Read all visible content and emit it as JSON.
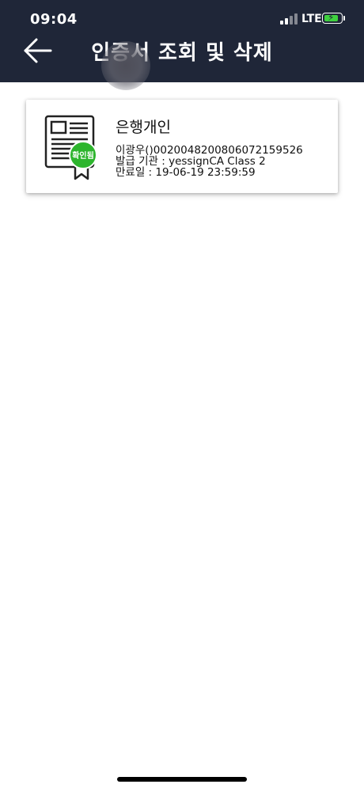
{
  "status_bar": {
    "time": "09:04",
    "network": "LTE",
    "battery_level": 0.85,
    "battery_charging": true
  },
  "header": {
    "title": "인증서 조회 및 삭제",
    "back_icon": "arrow-left-icon",
    "background_color": "#1f2638"
  },
  "certificates": [
    {
      "name": "은행개인",
      "owner_line": "이광우()0020048200806072159526",
      "issuer_line": "발급 기관 : yessignCA Class 2",
      "expiry_line": "만료일 : 19-06-19 23:59:59",
      "badge": "확인됨",
      "badge_color": "#2db52d",
      "icon": "certificate-icon"
    }
  ]
}
